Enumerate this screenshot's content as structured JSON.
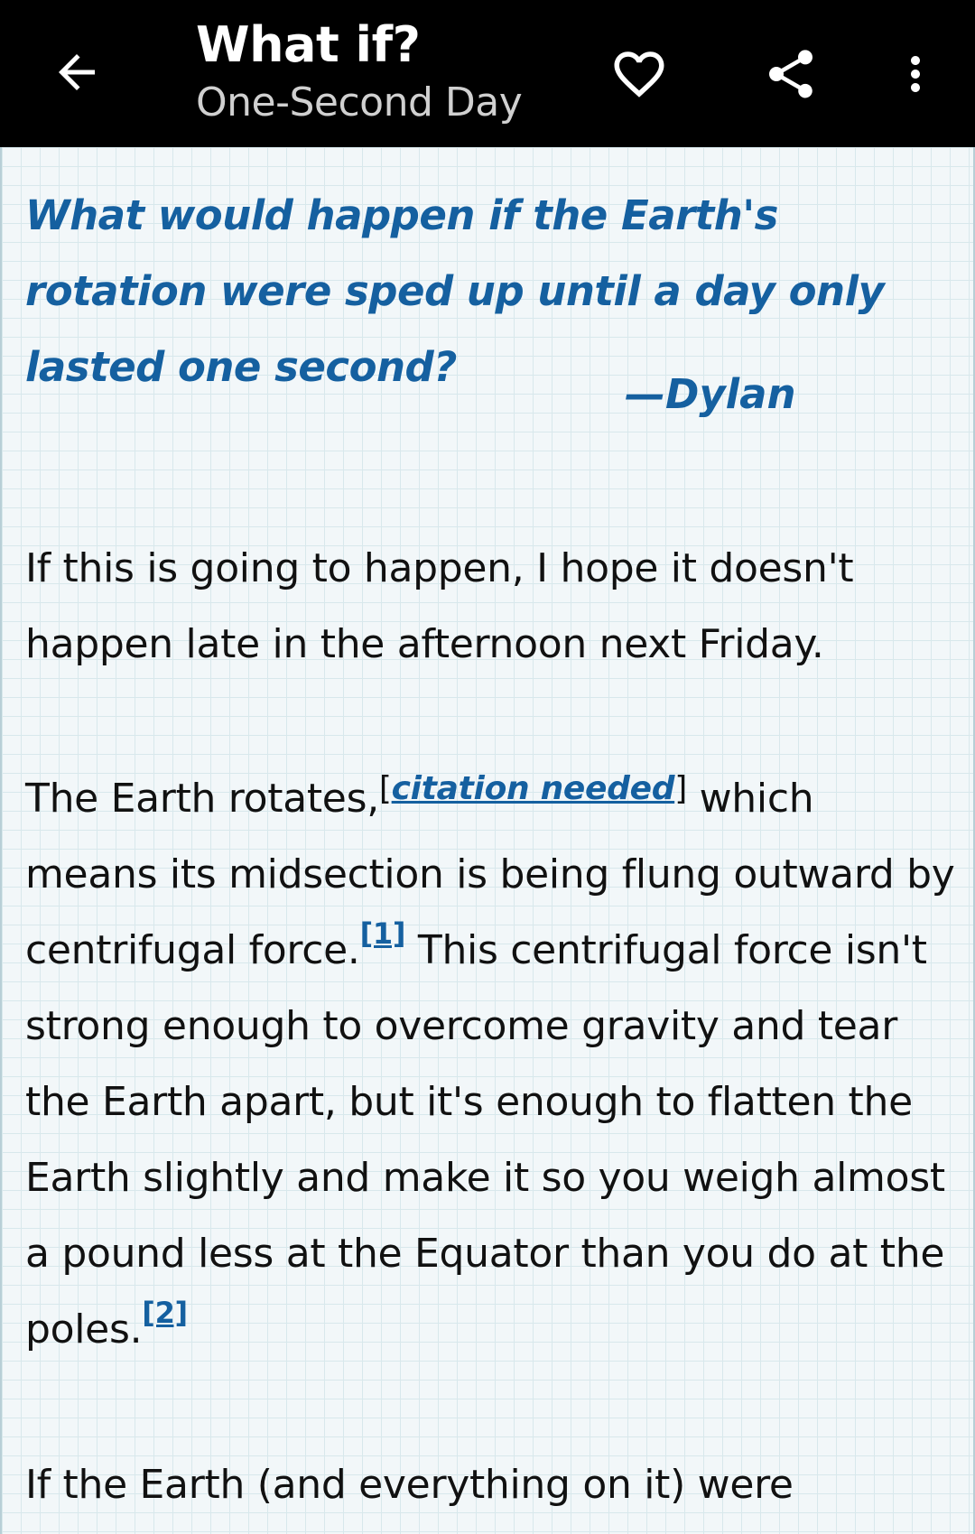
{
  "appbar": {
    "title": "What if?",
    "subtitle": "One-Second Day",
    "icons": {
      "back": "arrow-left-icon",
      "favorite": "heart-icon",
      "share": "share-icon",
      "more": "more-vertical-icon"
    }
  },
  "article": {
    "question": "What would happen if the Earth's rotation were sped up until a day only lasted one second?",
    "author": "—Dylan",
    "p1": "If this is going to happen, I hope it doesn't happen late in the afternoon next Friday.",
    "p2_a": "The Earth rotates,",
    "cite_open": "[",
    "cite_text": "citation needed",
    "cite_close": "]",
    "p2_b": " which means its midsection is being flung outward by centrifugal force.",
    "ref1": "[1]",
    "p2_c": " This centrifugal force isn't strong enough to overcome gravity and tear the Earth apart, but it's enough to flatten the Earth slightly and make it so you weigh almost a pound less at the Equator than you do at the poles.",
    "ref2": "[2]",
    "p3": "If the Earth (and everything on it) were"
  },
  "colors": {
    "appbar_bg": "#000000",
    "accent": "#1560a0",
    "paper": "#f2f7f9",
    "grid": "#d8e8ec"
  }
}
